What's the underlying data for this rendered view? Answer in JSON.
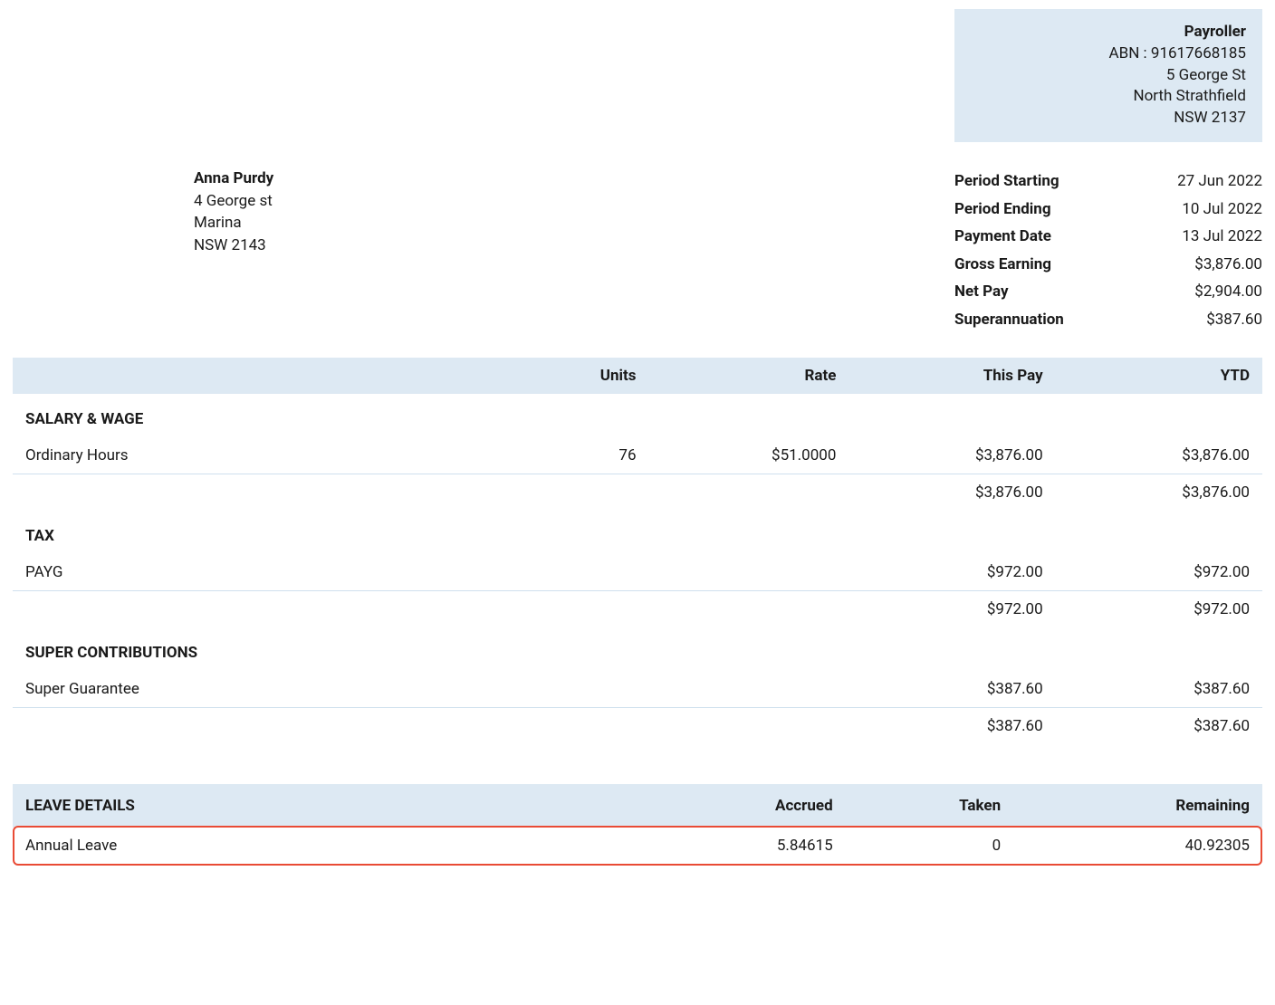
{
  "company": {
    "name": "Payroller",
    "abn": "ABN : 91617668185",
    "address1": "5 George St",
    "address2": "North Strathfield",
    "address3": "NSW 2137"
  },
  "employee": {
    "name": "Anna Purdy",
    "address1": "4 George st",
    "address2": "Marina",
    "address3": "NSW 2143"
  },
  "summary": {
    "period_starting_label": "Period Starting",
    "period_starting": "27 Jun 2022",
    "period_ending_label": "Period Ending",
    "period_ending": "10 Jul 2022",
    "payment_date_label": "Payment Date",
    "payment_date": "13 Jul 2022",
    "gross_label": "Gross Earning",
    "gross": "$3,876.00",
    "net_label": "Net Pay",
    "net": "$2,904.00",
    "super_label": "Superannuation",
    "super": "$387.60"
  },
  "table": {
    "headers": {
      "units": "Units",
      "rate": "Rate",
      "this_pay": "This Pay",
      "ytd": "YTD"
    },
    "salary_header": "SALARY & WAGE",
    "ordinary_label": "Ordinary Hours",
    "ordinary_units": "76",
    "ordinary_rate": "$51.0000",
    "ordinary_this": "$3,876.00",
    "ordinary_ytd": "$3,876.00",
    "salary_subtotal_this": "$3,876.00",
    "salary_subtotal_ytd": "$3,876.00",
    "tax_header": "TAX",
    "payg_label": "PAYG",
    "payg_this": "$972.00",
    "payg_ytd": "$972.00",
    "tax_subtotal_this": "$972.00",
    "tax_subtotal_ytd": "$972.00",
    "super_header": "SUPER CONTRIBUTIONS",
    "super_label": "Super Guarantee",
    "super_this": "$387.60",
    "super_ytd": "$387.60",
    "super_subtotal_this": "$387.60",
    "super_subtotal_ytd": "$387.60"
  },
  "leave": {
    "header": "LEAVE DETAILS",
    "accrued_h": "Accrued",
    "taken_h": "Taken",
    "remaining_h": "Remaining",
    "annual_label": "Annual Leave",
    "annual_accrued": "5.84615",
    "annual_taken": "0",
    "annual_remaining": "40.92305"
  }
}
